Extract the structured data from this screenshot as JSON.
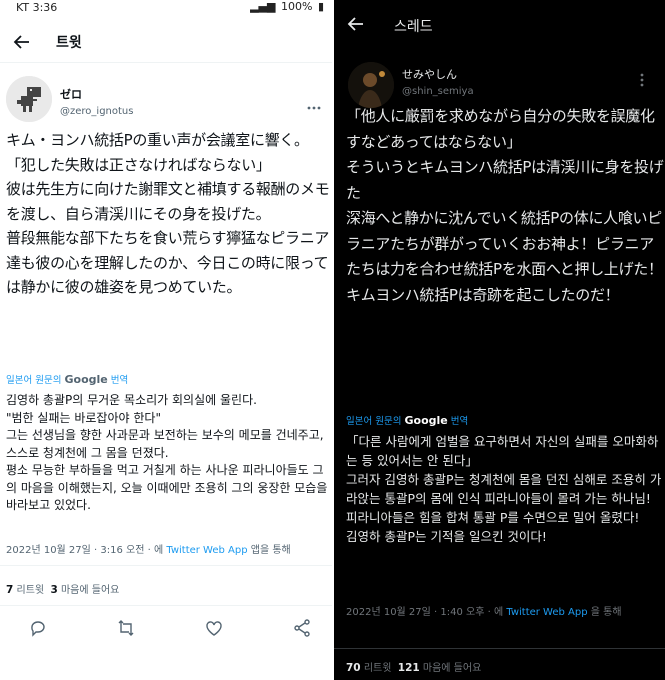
{
  "left": {
    "status_bar": {
      "carrier_time": "KT 3:36",
      "battery": "100%"
    },
    "header": {
      "title": "트윗"
    },
    "author": {
      "name": "ゼロ",
      "handle": "@zero_ignotus"
    },
    "tweet_jp": "キム・ヨンハ統括Pの重い声が会議室に響く。\n「犯した失敗は正さなければならない」\n彼は先生方に向けた謝罪文と補填する報酬のメモを渡し、自ら清渓川にその身を投げた。\n普段無能な部下たちを食い荒らす獰猛なピラニア達も彼の心を理解したのか、今日この時に限っては静かに彼の雄姿を見つめていた。",
    "translation": {
      "prefix": "일본어 원문의",
      "brand": "Google",
      "suffix": "번역"
    },
    "tweet_kr": "김영하 총괄P의 무거운 목소리가 회의실에 울린다.\n\"범한 실패는 바로잡아야 한다\"\n그는 선생님을 향한 사과문과 보전하는 보수의 메모를 건네주고, 스스로 청계천에 그 몸을 던졌다.\n평소 무능한 부하들을 먹고 거칠게 하는 사나운 피라니아들도 그의 마음을 이해했는지, 오늘 이때에만 조용히 그의 웅장한 모습을 바라보고 있었다.",
    "meta": {
      "date": "2022년 10월 27일 · 3:16 오전 · 에",
      "source": "Twitter Web App",
      "suffix": "앱을 통해"
    },
    "stats": {
      "retweets": "7",
      "retweets_label": "리트윗",
      "likes": "3",
      "likes_label": "마음에 들어요"
    },
    "actions": [
      "reply-icon",
      "retweet-icon",
      "like-icon",
      "share-icon"
    ]
  },
  "right": {
    "header": {
      "title": "스레드"
    },
    "author": {
      "name": "せみやしん",
      "handle": "@shin_semiya"
    },
    "tweet_jp": "「他人に厳罰を求めながら自分の失敗を誤魔化すなどあってはならない」\nそういうとキムヨンハ統括Pは清渓川に身を投げた\n深海へと静かに沈んでいく統括Pの体に人喰いピラニアたちが群がっていくおお神よ！ピラニアたちは力を合わせ統括Pを水面へと押し上げた！\nキムヨンハ統括Pは奇跡を起こしたのだ！",
    "translation": {
      "prefix": "일본어 원문의",
      "brand": "Google",
      "suffix": "번역"
    },
    "tweet_kr": "「다른 사람에게 엄벌을 요구하면서 자신의 실패를 오마화하는 등 있어서는 안 된다」\n그러자 김영하 총괄P는 청계천에 몸을 던진 심해로 조용히 가라앉는 통괄P의 몸에 인식 피라니아들이 몰려 가는 하나님! 피라니아들은 힘을 합쳐 통괄 P를 수면으로 밀어 올렸다!\n김영하 총괄P는 기적을 일으킨 것이다!",
    "meta": {
      "date": "2022년 10월 27일 · 1:40 오후 · 에",
      "source": "Twitter Web App",
      "suffix": "을 통해"
    },
    "stats": {
      "retweets": "70",
      "retweets_label": "리트윗",
      "likes": "121",
      "likes_label": "마음에 들어요"
    }
  },
  "colors": {
    "link": "#1d9bf0",
    "light_bg": "#ffffff",
    "dark_bg": "#000000"
  }
}
